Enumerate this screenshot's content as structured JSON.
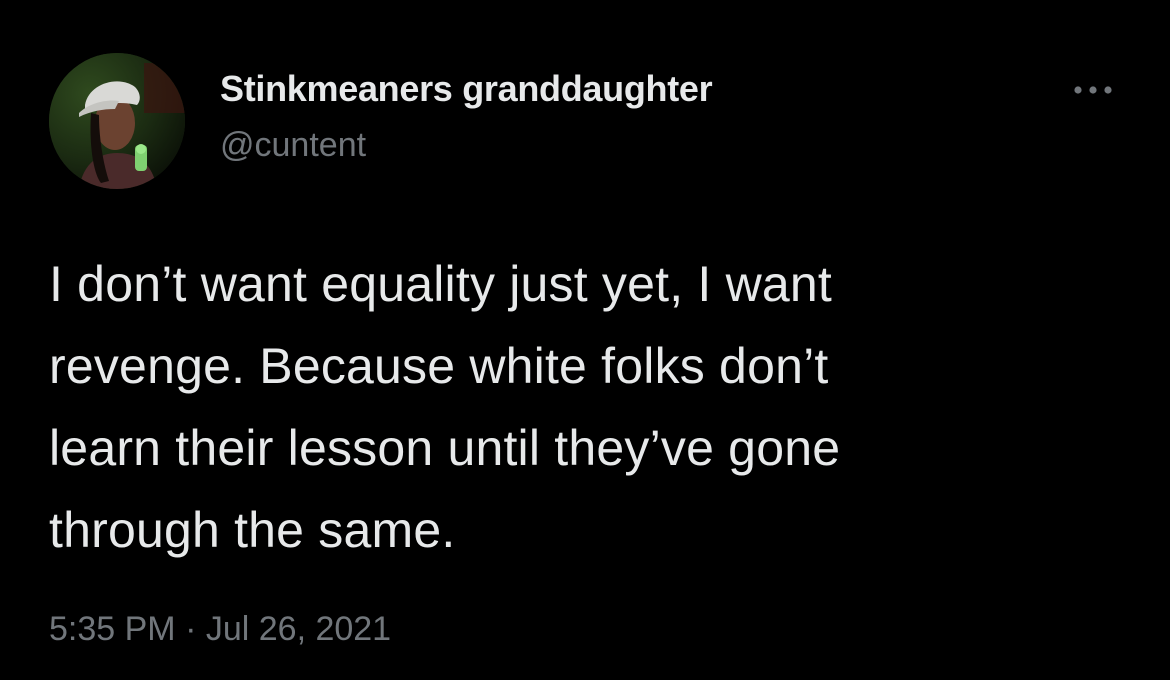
{
  "author": {
    "display_name": "Stinkmeaners granddaughter",
    "handle": "@cuntent",
    "avatar_icon": "profile-photo"
  },
  "menu": {
    "icon": "more-horizontal-icon"
  },
  "tweet": {
    "lines": [
      "I don’t want equality just yet, I want",
      "revenge. Because white folks don’t",
      "learn their lesson until they’ve gone",
      "through the same."
    ]
  },
  "meta": {
    "timestamp": "5:35 PM · Jul 26, 2021"
  },
  "colors": {
    "background": "#000000",
    "text_primary": "#e7e9ea",
    "text_secondary": "#71767b"
  }
}
